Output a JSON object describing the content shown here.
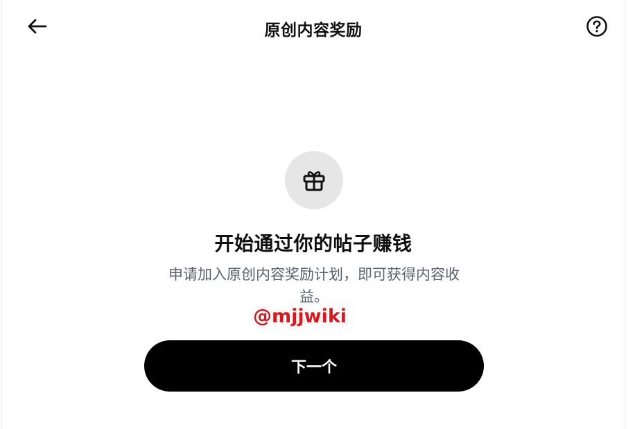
{
  "header": {
    "title": "原创内容奖励",
    "back_icon": "arrow-left-icon",
    "help_icon": "question-circle-icon"
  },
  "main": {
    "icon": "gift-icon",
    "headline": "开始通过你的帖子赚钱",
    "description": "申请加入原创内容奖励计划，即可获得内容收益。",
    "next_button_label": "下一个"
  },
  "watermark": {
    "text": "@mjjwiki"
  },
  "colors": {
    "accent": "#000000",
    "icon_circle_bg": "#e6e6e6",
    "subtext": "#5a6470",
    "watermark": "#e0141b"
  }
}
